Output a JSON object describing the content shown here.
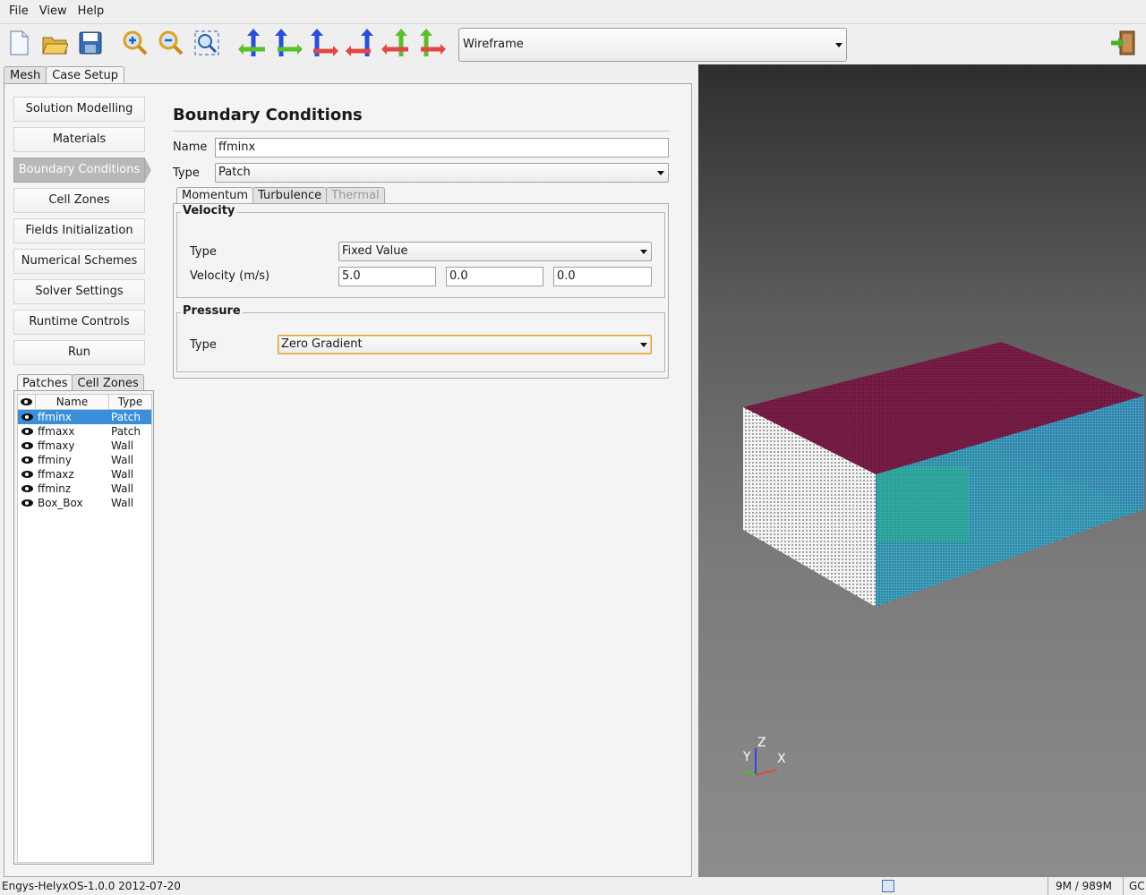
{
  "menu": {
    "file": "File",
    "view": "View",
    "help": "Help"
  },
  "toolbar": {
    "render_mode": "Wireframe"
  },
  "main_tabs": {
    "mesh": "Mesh",
    "case_setup": "Case Setup"
  },
  "nav": [
    {
      "label": "Solution Modelling"
    },
    {
      "label": "Materials"
    },
    {
      "label": "Boundary Conditions"
    },
    {
      "label": "Cell Zones"
    },
    {
      "label": "Fields Initialization"
    },
    {
      "label": "Numerical Schemes"
    },
    {
      "label": "Solver Settings"
    },
    {
      "label": "Runtime Controls"
    },
    {
      "label": "Run"
    }
  ],
  "patch_tabs": {
    "patches": "Patches",
    "cell_zones": "Cell Zones"
  },
  "patch_table": {
    "col_name": "Name",
    "col_type": "Type",
    "rows": [
      {
        "name": "ffminx",
        "type": "Patch"
      },
      {
        "name": "ffmaxx",
        "type": "Patch"
      },
      {
        "name": "ffmaxy",
        "type": "Wall"
      },
      {
        "name": "ffminy",
        "type": "Wall"
      },
      {
        "name": "ffmaxz",
        "type": "Wall"
      },
      {
        "name": "ffminz",
        "type": "Wall"
      },
      {
        "name": "Box_Box",
        "type": "Wall"
      }
    ]
  },
  "form": {
    "title": "Boundary Conditions",
    "name_label": "Name",
    "name_value": "ffminx",
    "type_label": "Type",
    "type_value": "Patch",
    "tabs": {
      "momentum": "Momentum",
      "turbulence": "Turbulence",
      "thermal": "Thermal"
    },
    "velocity": {
      "group": "Velocity",
      "type_label": "Type",
      "type_value": "Fixed Value",
      "vel_label": "Velocity (m/s)",
      "vx": "5.0",
      "vy": "0.0",
      "vz": "0.0"
    },
    "pressure": {
      "group": "Pressure",
      "type_label": "Type",
      "type_value": "Zero Gradient"
    }
  },
  "axes": {
    "z": "Z",
    "y": "Y",
    "x": "X"
  },
  "status": {
    "version": "Engys-HelyxOS-1.0.0 2012-07-20",
    "memory": "9M / 989M",
    "gc": "GC"
  }
}
